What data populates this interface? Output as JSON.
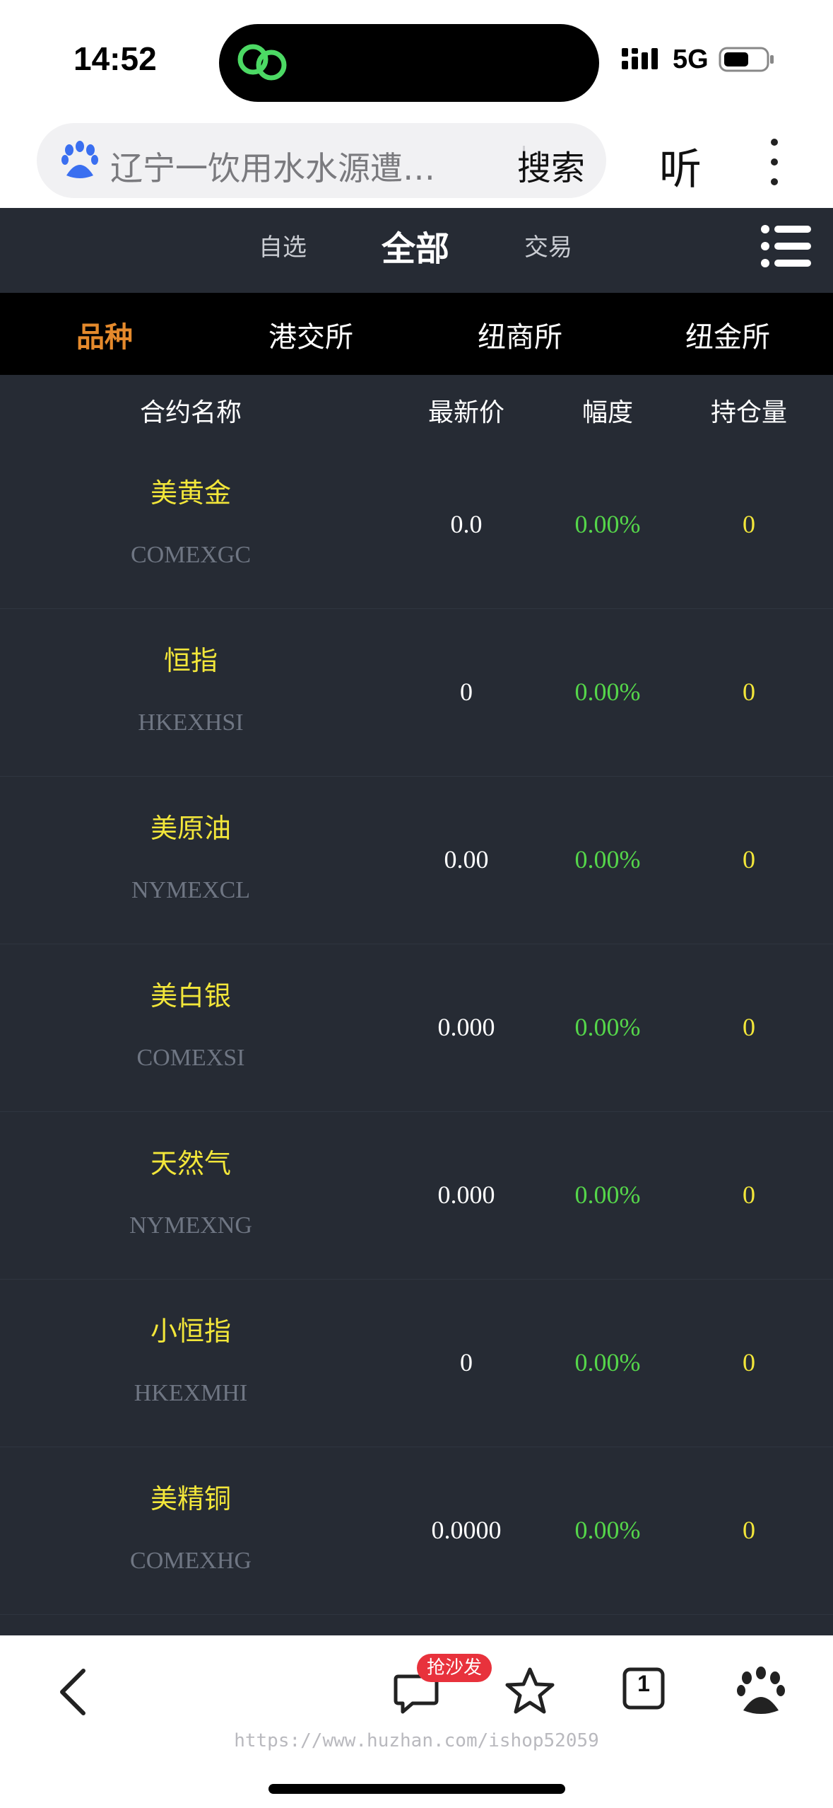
{
  "status_bar": {
    "time": "14:52",
    "network": "5G"
  },
  "browser": {
    "search_text": "辽宁一饮用水水源遭…",
    "search_button": "搜索",
    "listen_button": "听"
  },
  "app_header": {
    "tabs": [
      {
        "label": "自选",
        "active": false
      },
      {
        "label": "全部",
        "active": true
      },
      {
        "label": "交易",
        "active": false
      }
    ]
  },
  "category_tabs": [
    {
      "label": "品种",
      "active": true
    },
    {
      "label": "港交所",
      "active": false
    },
    {
      "label": "纽商所",
      "active": false
    },
    {
      "label": "纽金所",
      "active": false
    }
  ],
  "table": {
    "columns": [
      "合约名称",
      "最新价",
      "幅度",
      "持仓量"
    ],
    "rows": [
      {
        "name": "美黄金",
        "code": "COMEXGC",
        "price": "0.0",
        "change": "0.00%",
        "open_interest": "0"
      },
      {
        "name": "恒指",
        "code": "HKEXHSI",
        "price": "0",
        "change": "0.00%",
        "open_interest": "0"
      },
      {
        "name": "美原油",
        "code": "NYMEXCL",
        "price": "0.00",
        "change": "0.00%",
        "open_interest": "0"
      },
      {
        "name": "美白银",
        "code": "COMEXSI",
        "price": "0.000",
        "change": "0.00%",
        "open_interest": "0"
      },
      {
        "name": "天然气",
        "code": "NYMEXNG",
        "price": "0.000",
        "change": "0.00%",
        "open_interest": "0"
      },
      {
        "name": "小恒指",
        "code": "HKEXMHI",
        "price": "0",
        "change": "0.00%",
        "open_interest": "0"
      },
      {
        "name": "美精铜",
        "code": "COMEXHG",
        "price": "0.0000",
        "change": "0.00%",
        "open_interest": "0"
      }
    ]
  },
  "bottom_bar": {
    "sofa_badge": "抢沙发",
    "tab_count": "1",
    "watermark": "https://www.huzhan.com/ishop52059"
  },
  "colors": {
    "panel_bg": "#262b34",
    "category_bg": "#000000",
    "accent_orange": "#e58a2c",
    "name_yellow": "#f2e63a",
    "change_green": "#55d64a",
    "badge_red": "#e8323c"
  },
  "icons": [
    "baidu-paw-icon",
    "menu-list-icon",
    "back-chevron-icon",
    "comment-icon",
    "star-icon",
    "tabs-icon",
    "baidu-icon",
    "signal-icon",
    "battery-icon",
    "link-app-icon"
  ]
}
